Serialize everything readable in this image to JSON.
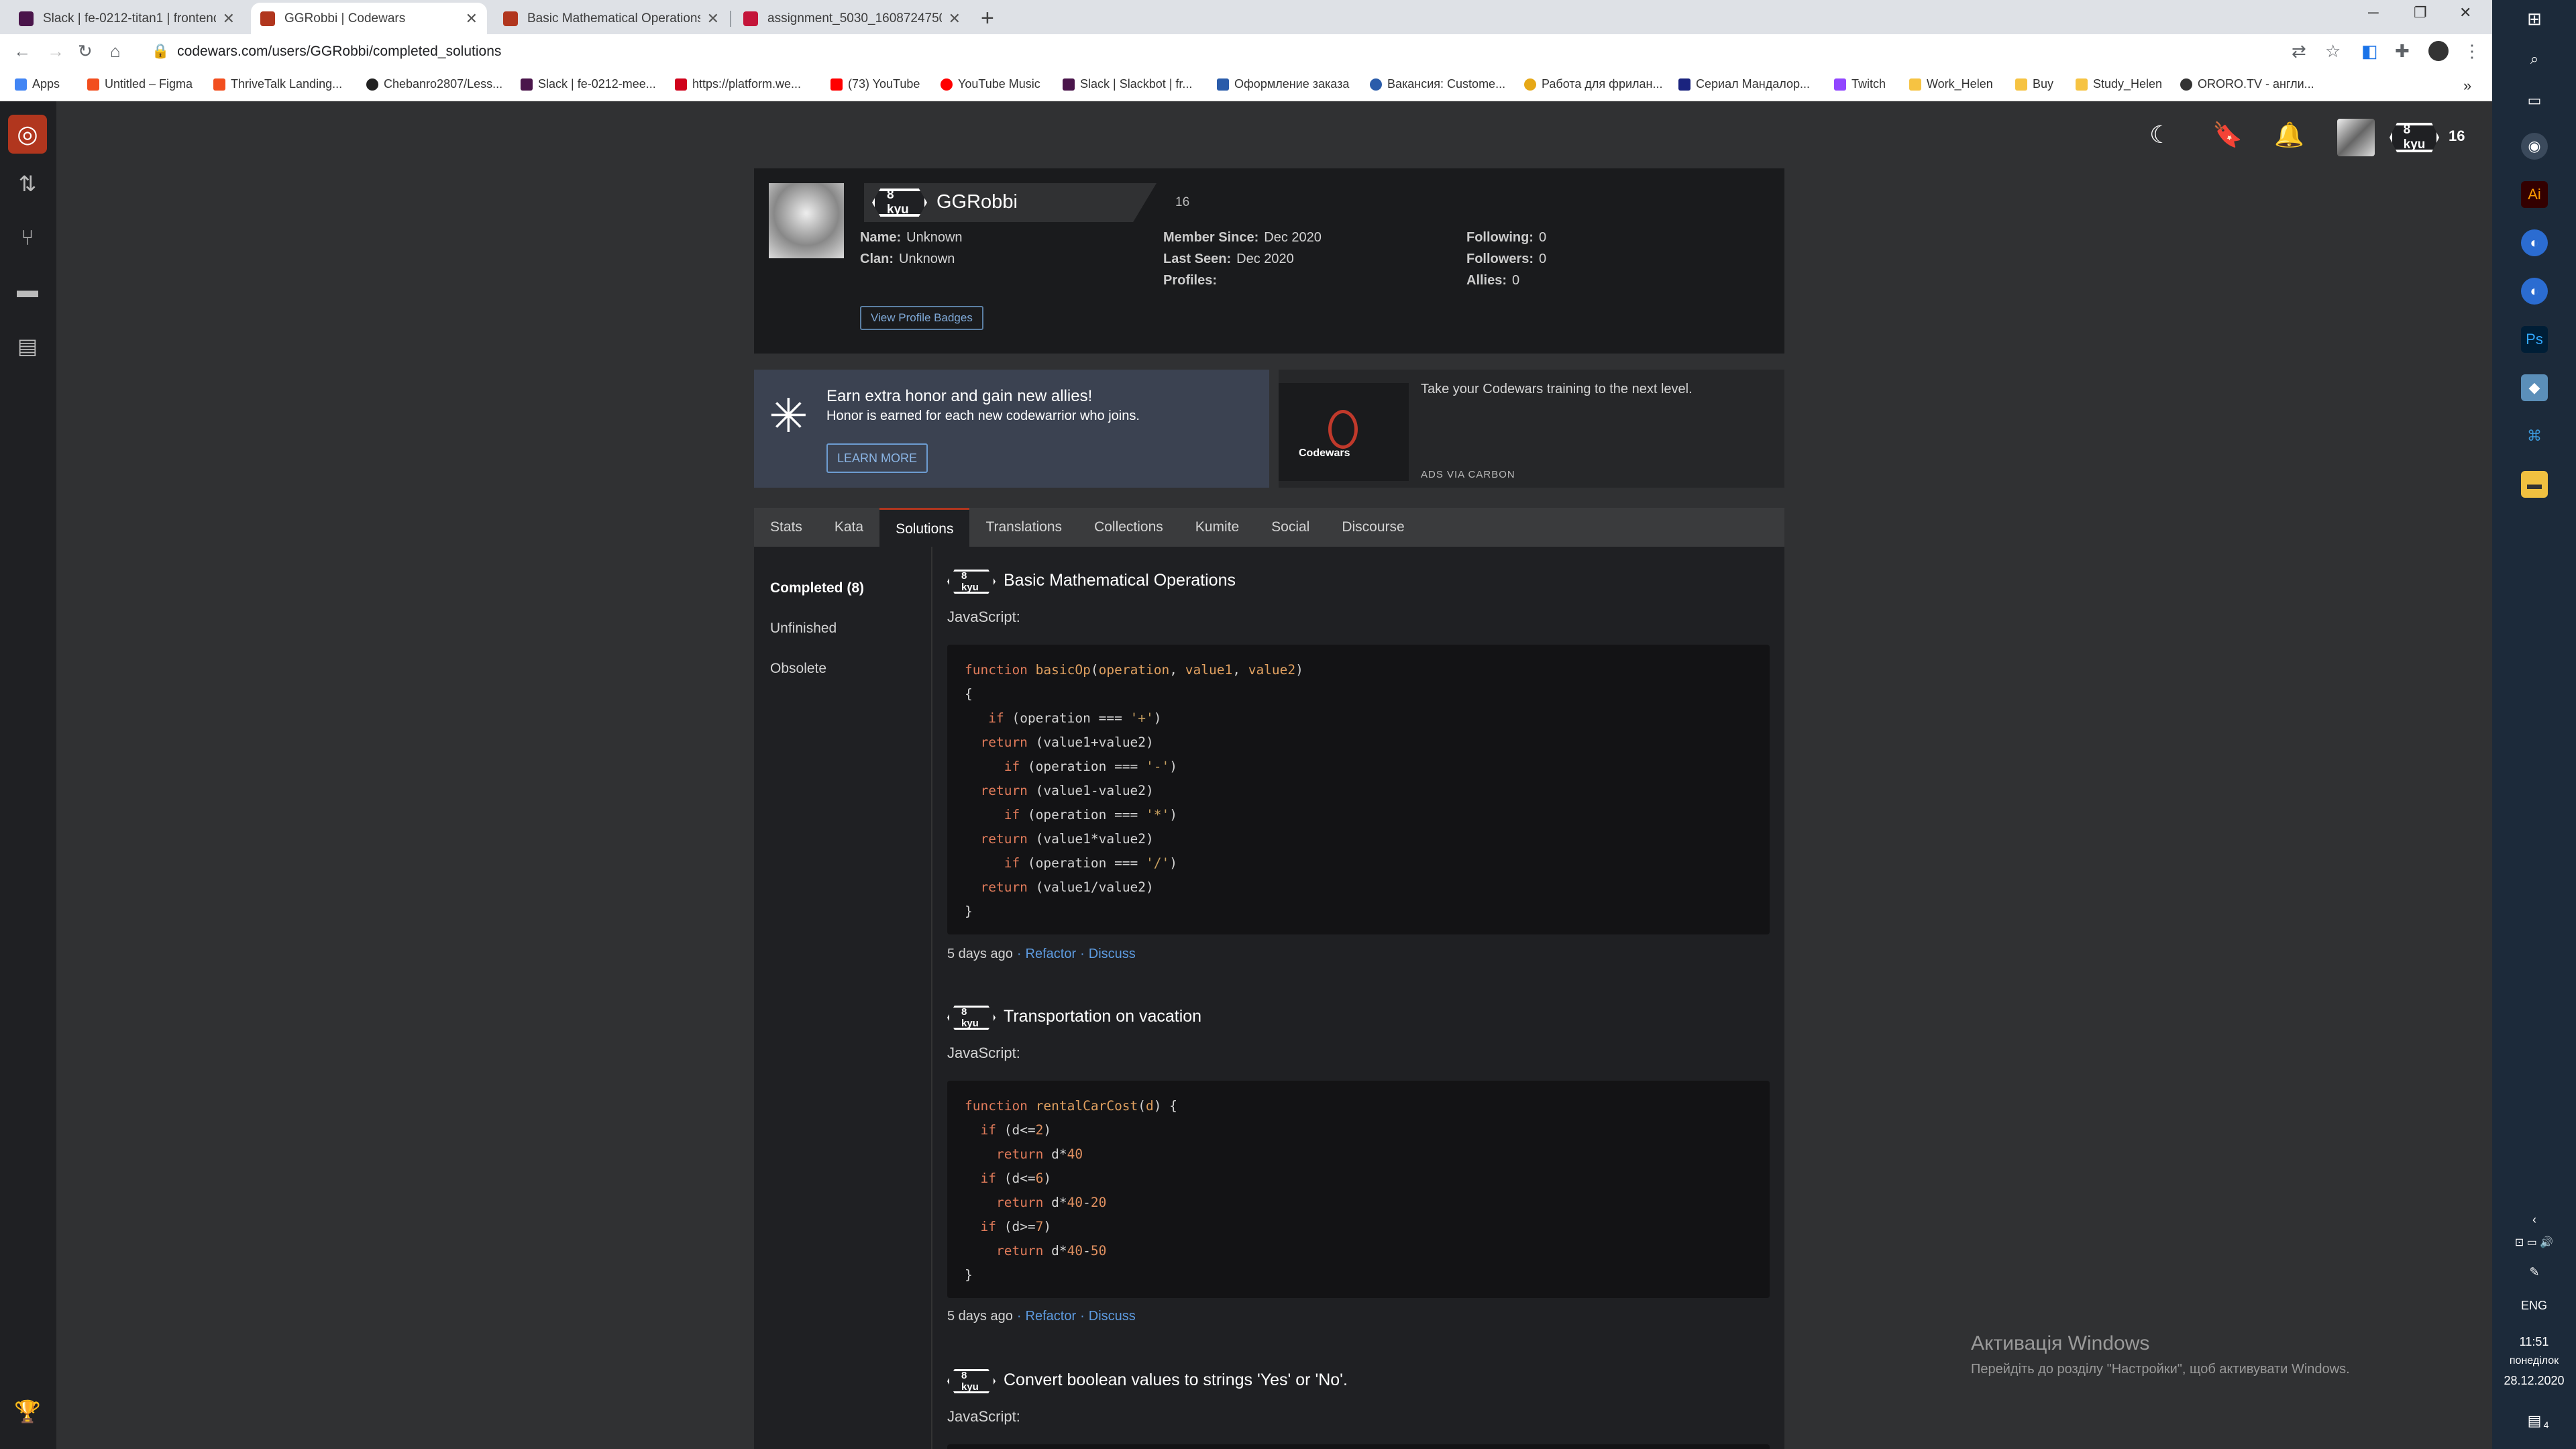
{
  "browser": {
    "tabs": [
      {
        "title": "Slack | fe-0212-titan1 | frontend",
        "favicon_color": "#4a154b"
      },
      {
        "title": "GGRobbi | Codewars",
        "favicon_color": "#b1361e"
      },
      {
        "title": "Basic Mathematical Operations | Codewars",
        "favicon_color": "#b1361e"
      },
      {
        "title": "assignment_5030_1608724750482",
        "favicon_color": "#c4153a"
      }
    ],
    "new_tab": "+",
    "url": "codewars.com/users/GGRobbi/completed_solutions",
    "bookmarks": [
      {
        "label": "Apps",
        "color": "#4285f4"
      },
      {
        "label": "Untitled – Figma",
        "color": "#f24e1e"
      },
      {
        "label": "ThriveTalk Landing...",
        "color": "#f24e1e"
      },
      {
        "label": "Chebanro2807/Less...",
        "color": "#222222"
      },
      {
        "label": "Slack | fe-0212-mee...",
        "color": "#4a154b"
      },
      {
        "label": "https://platform.we...",
        "color": "#d0021b"
      },
      {
        "label": "(73) YouTube",
        "color": "#ff0000"
      },
      {
        "label": "YouTube Music",
        "color": "#ff0000"
      },
      {
        "label": "Slack | Slackbot | fr...",
        "color": "#4a154b"
      },
      {
        "label": "Оформление заказа",
        "color": "#2a5caa"
      },
      {
        "label": "Вакансия: Custome...",
        "color": "#2a5caa"
      },
      {
        "label": "Работа для фрилан...",
        "color": "#e6a817"
      },
      {
        "label": "Сериал Мандалор...",
        "color": "#1a237e"
      },
      {
        "label": "Twitch",
        "color": "#9146ff"
      },
      {
        "label": "Work_Helen",
        "color": "#f6c342"
      },
      {
        "label": "Buy",
        "color": "#f6c342"
      },
      {
        "label": "Study_Helen",
        "color": "#f6c342"
      },
      {
        "label": "ORORO.TV - англи...",
        "color": "#333333"
      }
    ],
    "more_bookmarks": "»"
  },
  "nav": {
    "kyu": "8 kyu",
    "honor": "16"
  },
  "profile": {
    "kyu": "8 kyu",
    "username": "GGRobbi",
    "honor": "16",
    "name_label": "Name:",
    "name_value": "Unknown",
    "clan_label": "Clan:",
    "clan_value": "Unknown",
    "member_label": "Member Since:",
    "member_value": "Dec 2020",
    "seen_label": "Last Seen:",
    "seen_value": "Dec 2020",
    "profiles_label": "Profiles:",
    "following_label": "Following:",
    "following_value": "0",
    "followers_label": "Followers:",
    "followers_value": "0",
    "allies_label": "Allies:",
    "allies_value": "0",
    "badges_button": "View Profile Badges"
  },
  "promo": {
    "title": "Earn extra honor and gain new allies!",
    "subtitle": "Honor is earned for each new codewarrior who joins.",
    "button": "LEARN MORE"
  },
  "carbon": {
    "image_word": "Codewars",
    "text": "Take your Codewars training to the next level.",
    "via": "ADS VIA CARBON"
  },
  "tabs": [
    "Stats",
    "Kata",
    "Solutions",
    "Translations",
    "Collections",
    "Kumite",
    "Social",
    "Discourse"
  ],
  "active_tab": "Solutions",
  "subnav": [
    "Completed (8)",
    "Unfinished",
    "Obsolete"
  ],
  "solutions": [
    {
      "kyu": "8 kyu",
      "title": "Basic Mathematical Operations",
      "language": "JavaScript:",
      "time": "5 days ago",
      "refactor": "Refactor",
      "discuss": "Discuss"
    },
    {
      "kyu": "8 kyu",
      "title": "Transportation on vacation",
      "language": "JavaScript:",
      "time": "5 days ago",
      "refactor": "Refactor",
      "discuss": "Discuss"
    },
    {
      "kyu": "8 kyu",
      "title": "Convert boolean values to strings 'Yes' or 'No'.",
      "language": "JavaScript:"
    }
  ],
  "windows": {
    "activation_title": "Активація Windows",
    "activation_sub": "Перейдіть до розділу \"Настройки\", щоб активувати Windows.",
    "lang": "ENG",
    "time": "11:51",
    "day": "понеділок",
    "date": "28.12.2020",
    "notif_count": "4"
  }
}
